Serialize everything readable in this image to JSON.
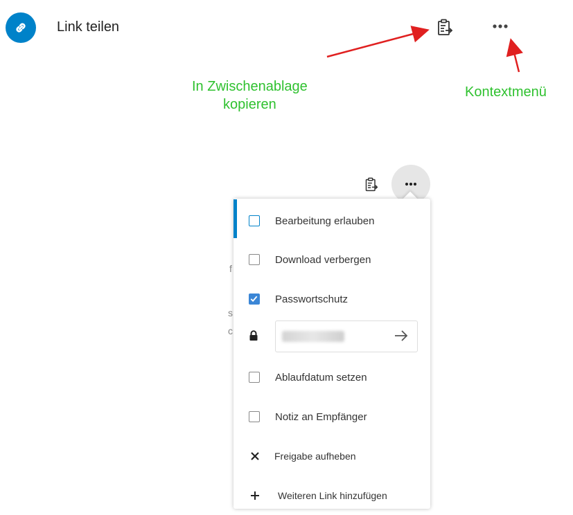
{
  "share": {
    "label": "Link teilen",
    "avatar_icon": "link-icon",
    "copy_icon": "clipboard-copy-icon",
    "menu_icon": "more-dots-icon"
  },
  "annotations": {
    "copy_line1": "In Zwischenablage",
    "copy_line2": "kopieren",
    "context_menu": "Kontextmenü",
    "color": "#2fc12f",
    "arrow_color": "#e02020"
  },
  "menu": {
    "items": [
      {
        "label": "Bearbeitung erlauben",
        "type": "checkbox",
        "checked": false
      },
      {
        "label": "Download verbergen",
        "type": "checkbox",
        "checked": false
      },
      {
        "label": "Passwortschutz",
        "type": "checkbox",
        "checked": true
      },
      {
        "label": "Ablaufdatum setzen",
        "type": "checkbox",
        "checked": false
      },
      {
        "label": "Notiz an Empfänger",
        "type": "checkbox",
        "checked": false
      },
      {
        "label": "Freigabe aufheben",
        "type": "action",
        "icon": "close-icon"
      },
      {
        "label": "Weiteren Link hinzufügen",
        "type": "action",
        "icon": "plus-icon"
      }
    ],
    "password": {
      "icon": "lock-icon",
      "submit_icon": "arrow-right-icon"
    }
  },
  "colors": {
    "accent": "#0082c9",
    "checkbox_checked": "#3b86d6"
  }
}
